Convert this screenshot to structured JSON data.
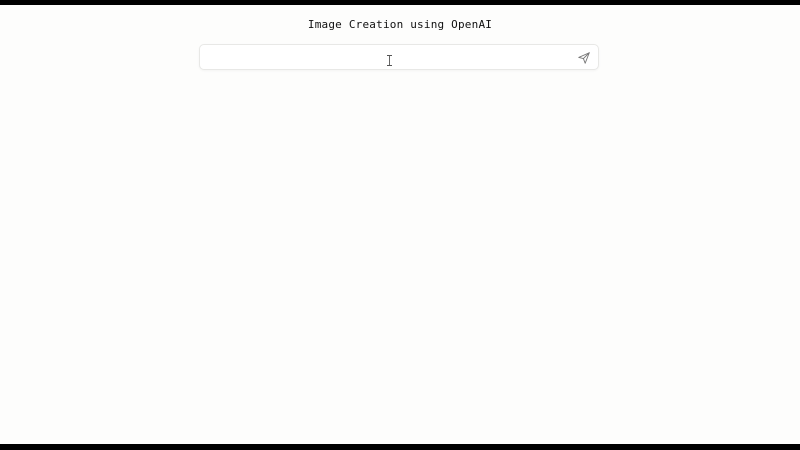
{
  "page": {
    "title": "Image Creation using OpenAI"
  },
  "prompt": {
    "value": "",
    "placeholder": "",
    "send_icon": "send-icon"
  },
  "colors": {
    "background": "#fdfdfc",
    "letterbox": "#000000",
    "text": "#111111",
    "border": "#e8e8e6"
  }
}
